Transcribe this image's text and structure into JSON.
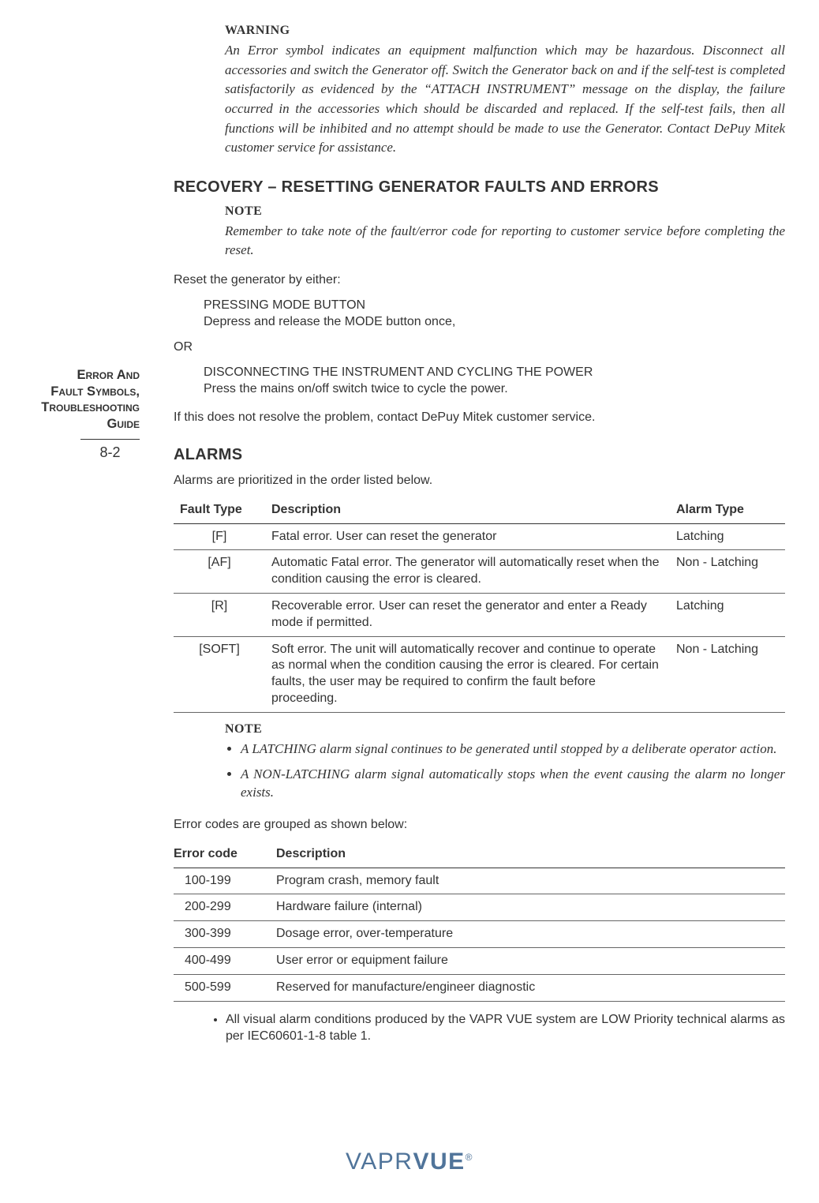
{
  "sidebar": {
    "title_l1": "Error And",
    "title_l2": "Fault Symbols,",
    "title_l3": "Troubleshooting",
    "title_l4": "Guide",
    "page_num": "8-2"
  },
  "warning": {
    "heading": "WARNING",
    "body": "An Error symbol indicates an equipment malfunction which may be hazardous. Disconnect all accessories and switch the Generator off. Switch the Generator back on and if the self-test is completed satisfactorily as evidenced by the “ATTACH INSTRUMENT” message on the display, the failure occurred in the accessories which should be discarded and replaced. If the self-test fails, then all functions will be inhibited and no attempt should be made to use the Generator. Contact DePuy Mitek customer service for assistance."
  },
  "recovery": {
    "heading": "RECOVERY – RESETTING GENERATOR FAULTS AND ERRORS",
    "note_heading": "NOTE",
    "note_body": "Remember to take note of the fault/error code for reporting to customer service before completing the reset.",
    "intro": "Reset the generator by either:",
    "opt1_title": "PRESSING MODE BUTTON",
    "opt1_body": "Depress and release the MODE button once,",
    "or": "OR",
    "opt2_title": "DISCONNECTING THE INSTRUMENT AND CYCLING THE POWER",
    "opt2_body": "Press the mains on/off switch twice to cycle the power.",
    "after": "If this does not resolve the problem, contact DePuy Mitek customer service."
  },
  "alarms": {
    "heading": "ALARMS",
    "intro": "Alarms are prioritized in the order listed below.",
    "headers": {
      "c1": "Fault Type",
      "c2": "Description",
      "c3": "Alarm Type"
    },
    "rows": [
      {
        "code": "[F]",
        "desc": "Fatal error. User can reset the generator",
        "type": "Latching"
      },
      {
        "code": "[AF]",
        "desc": "Automatic Fatal error. The generator will automatically reset when the condition causing the error is cleared.",
        "type": "Non - Latching"
      },
      {
        "code": "[R]",
        "desc": "Recoverable error. User can reset the generator and enter a Ready mode if permitted.",
        "type": "Latching"
      },
      {
        "code": "[SOFT]",
        "desc": "Soft error. The unit will automatically recover and continue to operate as normal when the condition causing the error is cleared. For certain faults, the user may be required to confirm the fault before proceeding.",
        "type": "Non - Latching"
      }
    ],
    "note2_heading": "NOTE",
    "note2_items": [
      "A LATCHING alarm signal continues to be generated until stopped by a deliberate operator action.",
      "A NON-LATCHING alarm signal automatically stops when the event causing the alarm no longer exists."
    ],
    "grouped_intro": "Error codes are grouped as shown below:",
    "codes_headers": {
      "c1": "Error code",
      "c2": "Description"
    },
    "codes_rows": [
      {
        "range": "100-199",
        "desc": "Program crash, memory fault"
      },
      {
        "range": "200-299",
        "desc": "Hardware failure (internal)"
      },
      {
        "range": "300-399",
        "desc": "Dosage error, over-temperature"
      },
      {
        "range": "400-499",
        "desc": "User error or equipment failure"
      },
      {
        "range": "500-599",
        "desc": "Reserved for manufacture/engineer diagnostic"
      }
    ],
    "bullet": "All visual alarm conditions produced by the VAPR VUE system are LOW Priority technical alarms as per IEC60601-1-8 table 1."
  },
  "footer": {
    "brand_thin": "VAPR",
    "brand_bold": "VUE",
    "reg": "®"
  }
}
